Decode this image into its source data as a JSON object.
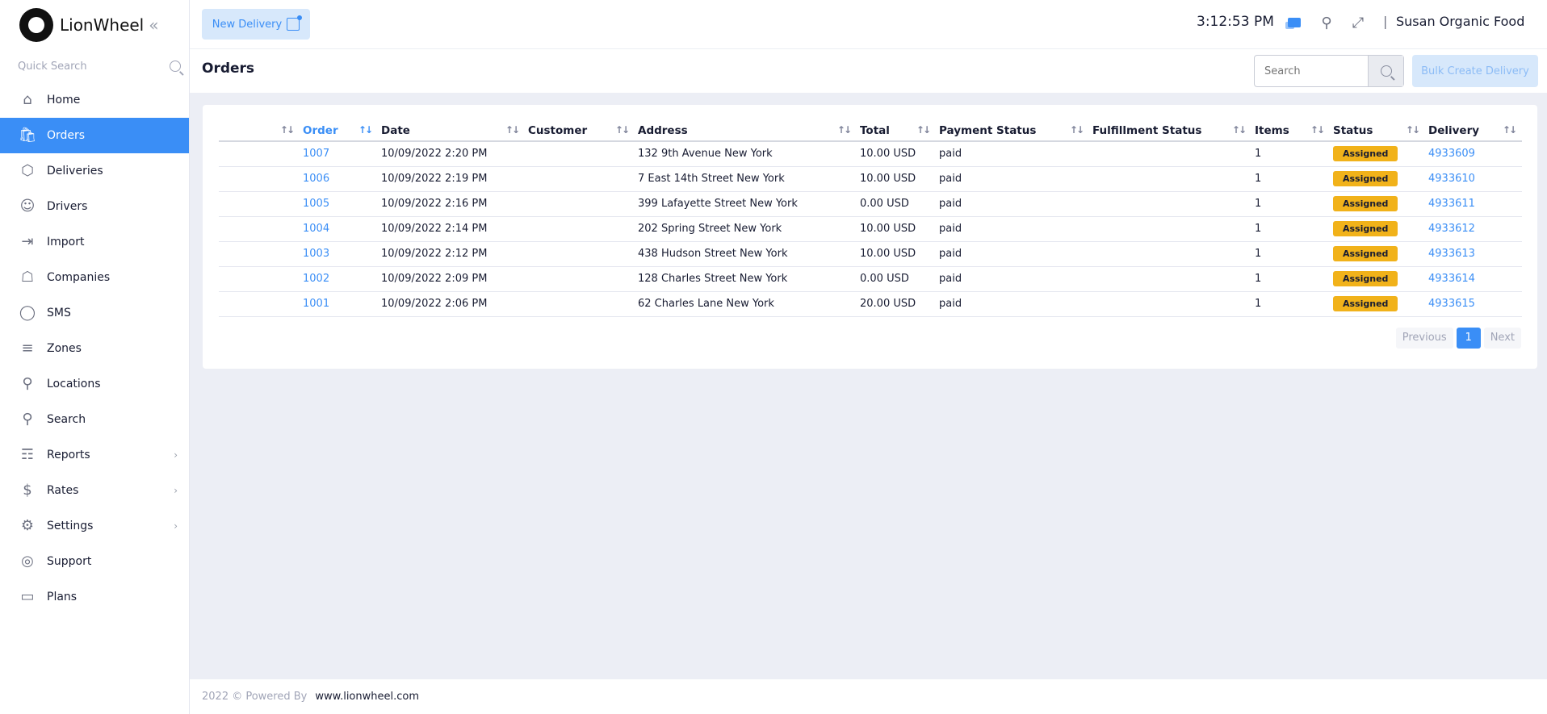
{
  "brand": {
    "name": "LionWheel"
  },
  "sidebar": {
    "quick_search_placeholder": "Quick Search",
    "items": [
      {
        "label": "Home",
        "icon": "home-icon",
        "active": false
      },
      {
        "label": "Orders",
        "icon": "shopify-bag-icon",
        "active": true
      },
      {
        "label": "Deliveries",
        "icon": "box-icon",
        "active": false
      },
      {
        "label": "Drivers",
        "icon": "users-icon",
        "active": false
      },
      {
        "label": "Import",
        "icon": "import-icon",
        "active": false
      },
      {
        "label": "Companies",
        "icon": "bank-icon",
        "active": false
      },
      {
        "label": "SMS",
        "icon": "chat-bubble-icon",
        "active": false
      },
      {
        "label": "Zones",
        "icon": "signpost-icon",
        "active": false
      },
      {
        "label": "Locations",
        "icon": "map-pin-icon",
        "active": false
      },
      {
        "label": "Search",
        "icon": "search-icon",
        "active": false
      },
      {
        "label": "Reports",
        "icon": "chart-icon",
        "active": false
      },
      {
        "label": "Rates",
        "icon": "dollar-icon",
        "active": false
      },
      {
        "label": "Settings",
        "icon": "gears-icon",
        "active": false
      },
      {
        "label": "Support",
        "icon": "lifebuoy-icon",
        "active": false
      },
      {
        "label": "Plans",
        "icon": "credit-card-icon",
        "active": false
      }
    ]
  },
  "topbar": {
    "new_delivery_label": "New Delivery",
    "clock": "3:12:53 PM",
    "separator": "|",
    "user_name": "Susan Organic Food"
  },
  "page": {
    "title": "Orders",
    "search_placeholder": "Search",
    "bulk_create_label": "Bulk Create Delivery"
  },
  "table": {
    "columns": [
      "Order",
      "Date",
      "Customer",
      "Address",
      "Total",
      "Payment Status",
      "Fulfillment Status",
      "Items",
      "Status",
      "Delivery"
    ],
    "rows": [
      {
        "order": "1007",
        "date": "10/09/2022 2:20 PM",
        "customer": "",
        "address": "132 9th Avenue New York",
        "total": "10.00 USD",
        "payment": "paid",
        "fulfillment": "",
        "items": "1",
        "status": "Assigned",
        "delivery": "4933609"
      },
      {
        "order": "1006",
        "date": "10/09/2022 2:19 PM",
        "customer": "",
        "address": "7 East 14th Street New York",
        "total": "10.00 USD",
        "payment": "paid",
        "fulfillment": "",
        "items": "1",
        "status": "Assigned",
        "delivery": "4933610"
      },
      {
        "order": "1005",
        "date": "10/09/2022 2:16 PM",
        "customer": "",
        "address": "399 Lafayette Street New York",
        "total": "0.00 USD",
        "payment": "paid",
        "fulfillment": "",
        "items": "1",
        "status": "Assigned",
        "delivery": "4933611"
      },
      {
        "order": "1004",
        "date": "10/09/2022 2:14 PM",
        "customer": "",
        "address": "202 Spring Street New York",
        "total": "10.00 USD",
        "payment": "paid",
        "fulfillment": "",
        "items": "1",
        "status": "Assigned",
        "delivery": "4933612"
      },
      {
        "order": "1003",
        "date": "10/09/2022 2:12 PM",
        "customer": "",
        "address": "438 Hudson Street New York",
        "total": "10.00 USD",
        "payment": "paid",
        "fulfillment": "",
        "items": "1",
        "status": "Assigned",
        "delivery": "4933613"
      },
      {
        "order": "1002",
        "date": "10/09/2022 2:09 PM",
        "customer": "",
        "address": "128 Charles Street New York",
        "total": "0.00 USD",
        "payment": "paid",
        "fulfillment": "",
        "items": "1",
        "status": "Assigned",
        "delivery": "4933614"
      },
      {
        "order": "1001",
        "date": "10/09/2022 2:06 PM",
        "customer": "",
        "address": "62 Charles Lane New York",
        "total": "20.00 USD",
        "payment": "paid",
        "fulfillment": "",
        "items": "1",
        "status": "Assigned",
        "delivery": "4933615"
      }
    ]
  },
  "pagination": {
    "previous": "Previous",
    "current": "1",
    "next": "Next"
  },
  "footer": {
    "copyright": "2022 © Powered By",
    "site": "www.lionwheel.com"
  },
  "colors": {
    "accent": "#3a8ef6",
    "status_assigned": "#f1b21a"
  }
}
